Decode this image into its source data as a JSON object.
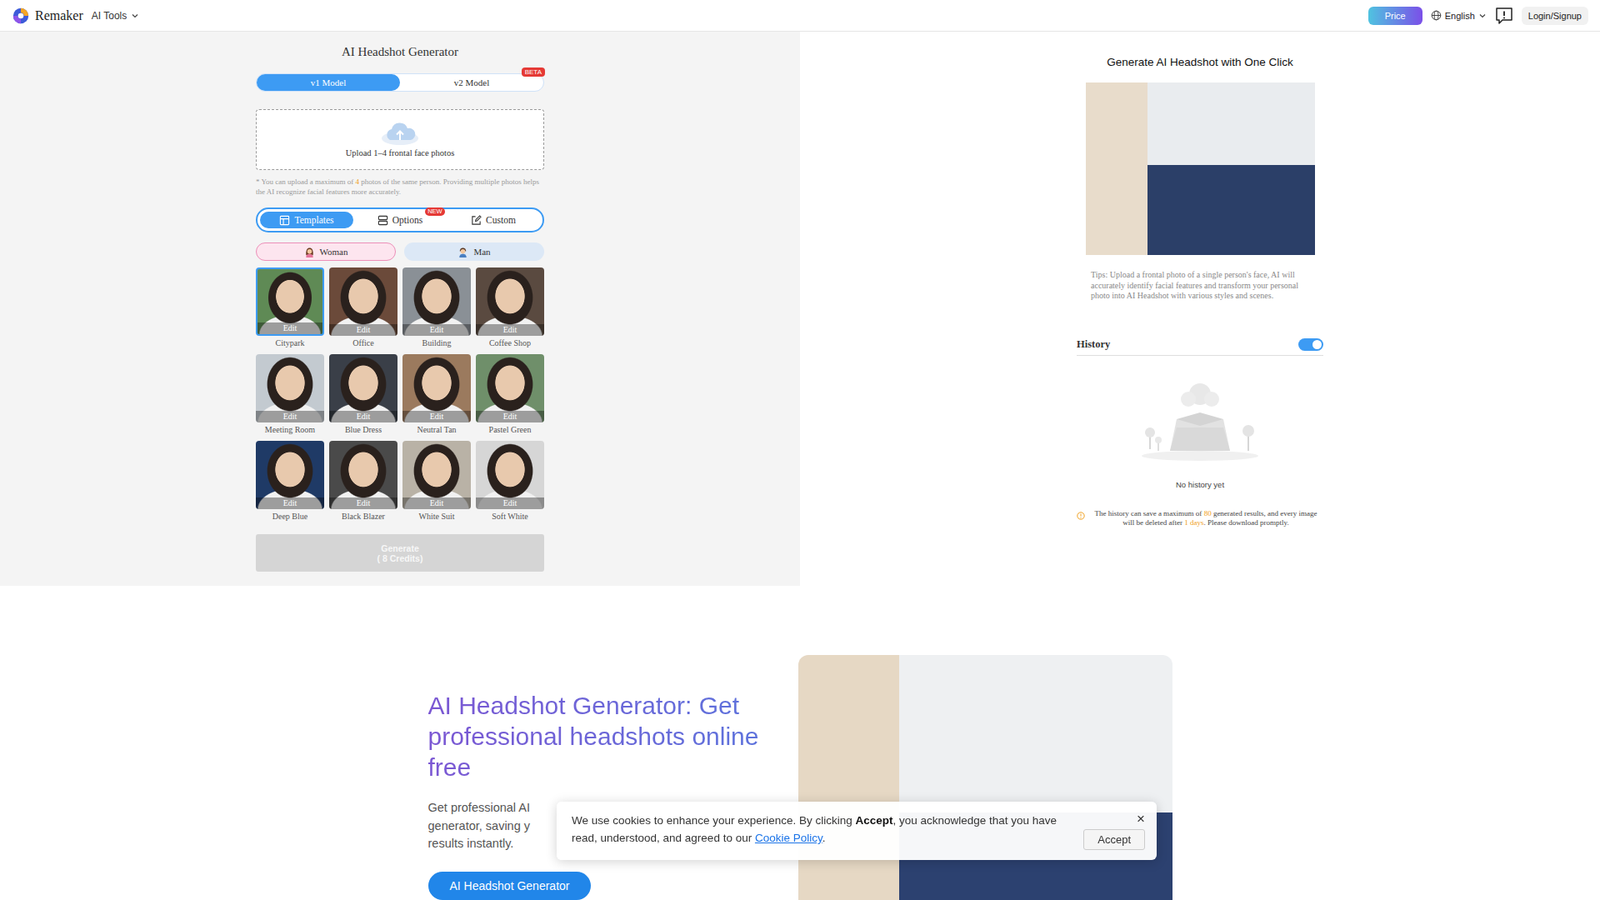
{
  "nav": {
    "brand": "Remaker",
    "tools": "AI Tools",
    "price": "Price",
    "language": "English",
    "login": "Login/Signup"
  },
  "generator": {
    "title": "AI Headshot Generator",
    "models": [
      {
        "label": "v1 Model",
        "selected": true,
        "badge": ""
      },
      {
        "label": "v2 Model",
        "selected": false,
        "badge": "BETA"
      }
    ],
    "upload_label": "Upload 1–4 frontal face photos",
    "note": [
      "* You can upload a maximum of ",
      "4",
      " photos of the same person. Providing multiple photos helps the AI recognize facial features more accurately."
    ],
    "modes": [
      {
        "label": "Templates",
        "selected": true,
        "badge": ""
      },
      {
        "label": "Options",
        "selected": false,
        "badge": "NEW"
      },
      {
        "label": "Custom",
        "selected": false,
        "badge": ""
      }
    ],
    "genders": [
      {
        "label": "Woman",
        "selected": true
      },
      {
        "label": "Man",
        "selected": false
      }
    ],
    "edit_label": "Edit",
    "templates": [
      {
        "name": "Citypark",
        "selected": true
      },
      {
        "name": "Office",
        "selected": false
      },
      {
        "name": "Building",
        "selected": false
      },
      {
        "name": "Coffee Shop",
        "selected": false
      },
      {
        "name": "Meeting Room",
        "selected": false
      },
      {
        "name": "Blue Dress",
        "selected": false
      },
      {
        "name": "Neutral Tan",
        "selected": false
      },
      {
        "name": "Pastel Green",
        "selected": false
      },
      {
        "name": "Deep Blue",
        "selected": false
      },
      {
        "name": "Black Blazer",
        "selected": false
      },
      {
        "name": "White Suit",
        "selected": false
      },
      {
        "name": "Soft White",
        "selected": false
      }
    ],
    "generate": {
      "label": "Generate",
      "credits": "( 8 Credits)",
      "disabled": true
    }
  },
  "preview": {
    "title": "Generate AI Headshot with One Click",
    "tips": "Tips: Upload a frontal photo of a single person's face, AI will accurately identify facial features and transform your personal photo into AI Headshot with various styles and scenes."
  },
  "history": {
    "title": "History",
    "enabled": true,
    "empty": "No history yet",
    "note": [
      "The history can save a maximum of ",
      "80",
      " generated results, and every image will be deleted after ",
      "1 days",
      ". Please download promptly."
    ]
  },
  "hero": {
    "title_lines": [
      "AI Headshot Generator: Get",
      "professional headshots online",
      "free"
    ],
    "text_lines": [
      "Get professional AI",
      "generator, saving y",
      "results instantly."
    ],
    "button": "AI Headshot Generator"
  },
  "cookie": {
    "before": "We use cookies to enhance your experience. By clicking ",
    "bold": "Accept",
    "middle": ", you acknowledge that you have read, understood, and agreed to our ",
    "link": "Cookie Policy",
    "after": ".",
    "close": "×",
    "accept": "Accept"
  }
}
